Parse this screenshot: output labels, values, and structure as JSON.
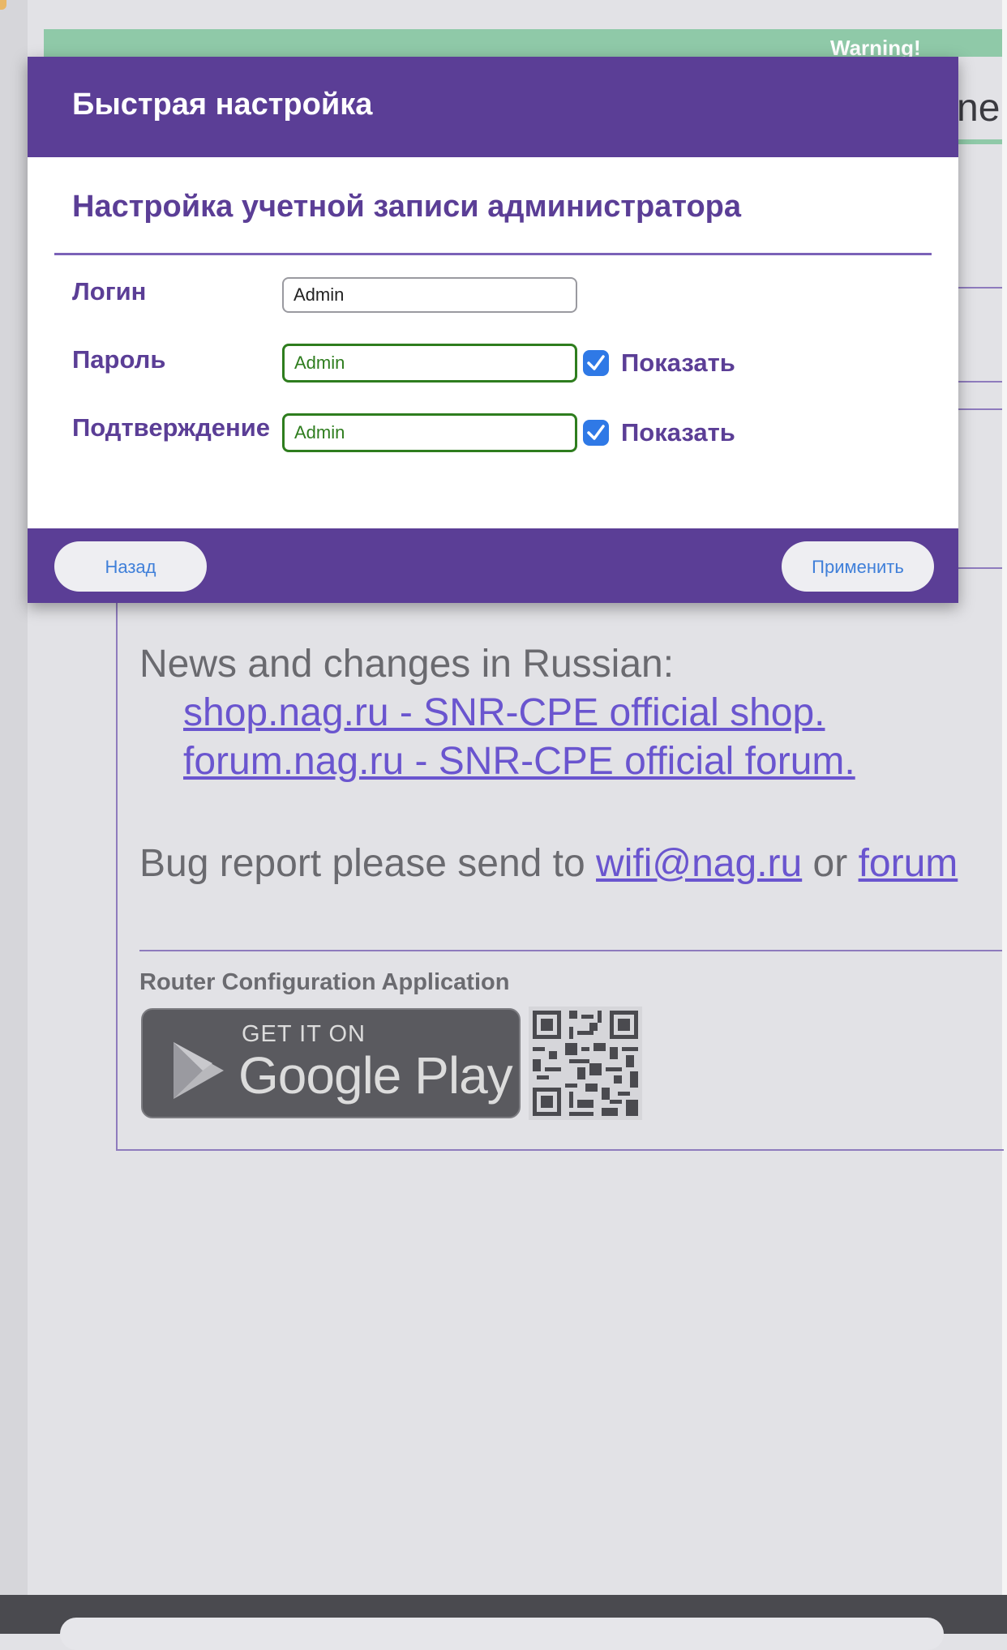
{
  "background": {
    "warning_text": "Warning!",
    "header_fragment": "ne",
    "news_title": "News and changes in Russian:",
    "links": [
      "shop.nag.ru - SNR-CPE official shop.",
      "forum.nag.ru - SNR-CPE official forum."
    ],
    "bug_report_prefix": "Bug report please send to",
    "bug_report_email": "wifi@nag.ru",
    "bug_report_or": "or",
    "bug_report_forum": "forum",
    "app_label": "Router Configuration Application",
    "google_play": {
      "get_it_on": "GET IT ON",
      "store_name": "Google Play"
    }
  },
  "modal": {
    "title": "Быстрая настройка",
    "section_title": "Настройка учетной записи администратора",
    "fields": {
      "login": {
        "label": "Логин",
        "value": "Admin"
      },
      "password": {
        "label": "Пароль",
        "value": "Admin",
        "show_label": "Показать",
        "show_checked": true
      },
      "confirm": {
        "label": "Подтверждение",
        "value": "Admin",
        "show_label": "Показать",
        "show_checked": true
      }
    },
    "buttons": {
      "back": "Назад",
      "apply": "Применить"
    }
  },
  "colors": {
    "accent_purple": "#5b3e96",
    "valid_green": "#2e7d1e",
    "checkbox_blue": "#2f79e6",
    "link_color": "#6a55cf"
  }
}
